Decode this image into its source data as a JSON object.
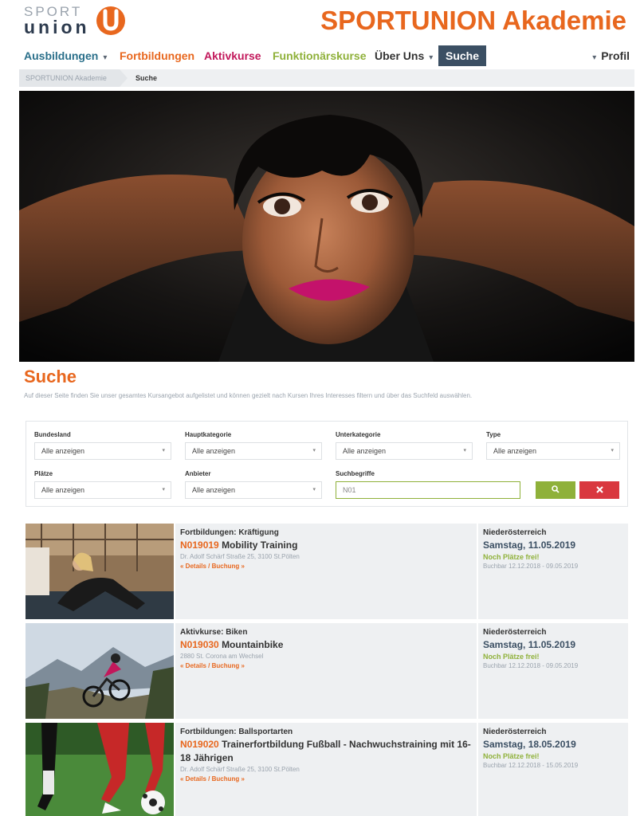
{
  "logo": {
    "sport": "SPORT",
    "union": "union"
  },
  "header": {
    "title": "SPORTUNION Akademie"
  },
  "nav": {
    "items": [
      {
        "label": "Ausbildungen",
        "has_caret": true,
        "color": "#2a6f8a"
      },
      {
        "label": "Fortbildungen",
        "has_caret": false,
        "color": "#e8671e"
      },
      {
        "label": "Aktivkurse",
        "has_caret": false,
        "color": "#c2185b"
      },
      {
        "label": "Funktionärskurse",
        "has_caret": false,
        "color": "#8fb13a"
      },
      {
        "label": "Über Uns",
        "has_caret": true,
        "color": "#333333"
      },
      {
        "label": "Suche",
        "has_caret": false,
        "active": true
      },
      {
        "label": "Profil",
        "has_caret": true,
        "color": "#333333"
      }
    ]
  },
  "breadcrumb": {
    "items": [
      "SPORTUNION Akademie",
      "Suche"
    ]
  },
  "search": {
    "title": "Suche",
    "intro": "Auf dieser Seite finden Sie unser gesamtes Kursangebot aufgelistet und können gezielt nach Kursen Ihres Interesses filtern und über das Suchfeld auswählen.",
    "filters": {
      "bundesland": {
        "label": "Bundesland",
        "value": "Alle anzeigen"
      },
      "hauptkategorie": {
        "label": "Hauptkategorie",
        "value": "Alle anzeigen"
      },
      "unterkategorie": {
        "label": "Unterkategorie",
        "value": "Alle anzeigen"
      },
      "type": {
        "label": "Type",
        "value": "Alle anzeigen"
      },
      "plaetze": {
        "label": "Plätze",
        "value": "Alle anzeigen"
      },
      "anbieter": {
        "label": "Anbieter",
        "value": "Alle anzeigen"
      },
      "suchbegriffe": {
        "label": "Suchbegriffe",
        "value": "N01"
      }
    },
    "search_icon": "search-icon",
    "clear_icon": "close-icon"
  },
  "results": [
    {
      "category": "Fortbildungen: Kräftigung",
      "code": "N019019",
      "title": "Mobility Training",
      "address": "Dr. Adolf Schärf Straße 25, 3100 St.Pölten",
      "link": "« Details / Buchung »",
      "region": "Niederösterreich",
      "date": "Samstag, 11.05.2019",
      "availability": "Noch Plätze frei!",
      "bookable": "Buchbar 12.12.2018 - 09.05.2019"
    },
    {
      "category": "Aktivkurse: Biken",
      "code": "N019030",
      "title": "Mountainbike",
      "address": "2880 St. Corona am Wechsel",
      "link": "« Details / Buchung »",
      "region": "Niederösterreich",
      "date": "Samstag, 11.05.2019",
      "availability": "Noch Plätze frei!",
      "bookable": "Buchbar 12.12.2018 - 09.05.2019"
    },
    {
      "category": "Fortbildungen: Ballsportarten",
      "code": "N019020",
      "title": "Trainerfortbildung Fußball - Nachwuchstraining mit 16-18 Jährigen",
      "address": "Dr. Adolf Schärf Straße 25, 3100 St.Pölten",
      "link": "« Details / Buchung »",
      "region": "Niederösterreich",
      "date": "Samstag, 18.05.2019",
      "availability": "Noch Plätze frei!",
      "bookable": "Buchbar 12.12.2018 - 15.05.2019"
    }
  ],
  "colors": {
    "brand_orange": "#e8671e",
    "nav_active_bg": "#3b4f63",
    "green": "#8fb13a",
    "red": "#d9383f"
  }
}
